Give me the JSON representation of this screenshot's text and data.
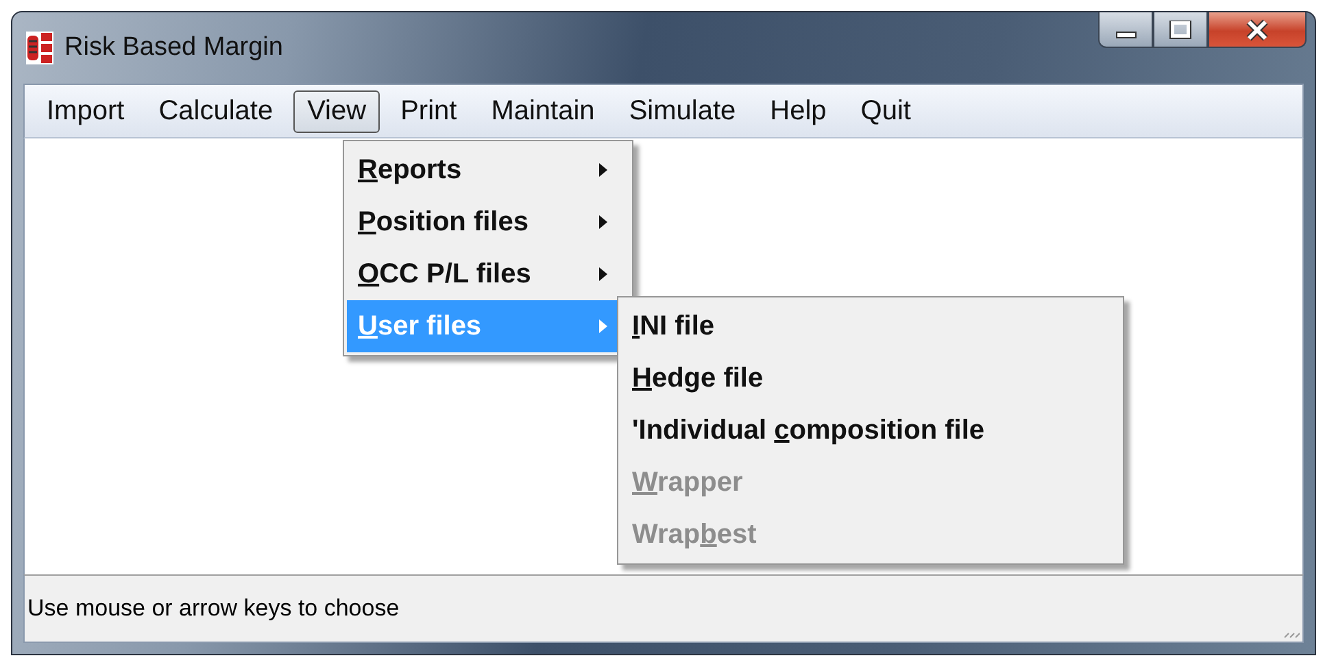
{
  "window": {
    "title": "Risk Based Margin",
    "controls": [
      {
        "kind": "minimize"
      },
      {
        "kind": "maximize"
      },
      {
        "kind": "close"
      }
    ]
  },
  "menu_bar": [
    {
      "label": "Import",
      "selected": false
    },
    {
      "label": "Calculate",
      "selected": false
    },
    {
      "label": "View",
      "selected": true
    },
    {
      "label": "Print",
      "selected": false
    },
    {
      "label": "Maintain",
      "selected": false
    },
    {
      "label": "Simulate",
      "selected": false
    },
    {
      "label": "Help",
      "selected": false
    },
    {
      "label": "Quit",
      "selected": false
    }
  ],
  "view_menu": [
    {
      "key": "R",
      "post": "eports",
      "submenu": true,
      "selected": false
    },
    {
      "key": "P",
      "post": "osition files",
      "submenu": true,
      "selected": false
    },
    {
      "key": "O",
      "post": "CC P/L files",
      "submenu": true,
      "selected": false
    },
    {
      "key": "U",
      "post": "ser files",
      "submenu": true,
      "selected": true
    }
  ],
  "user_files_menu": [
    {
      "key": "I",
      "post": "NI file",
      "disabled": false
    },
    {
      "key": "H",
      "post": "edge file",
      "disabled": false
    },
    {
      "pre": "'Individual ",
      "key": "c",
      "post": "omposition file",
      "disabled": false
    },
    {
      "key": "W",
      "post": "rapper",
      "disabled": true
    },
    {
      "pre": "Wrap",
      "key": "b",
      "post": "est",
      "disabled": true
    }
  ],
  "status_bar": {
    "text": "Use mouse or arrow keys to choose"
  }
}
